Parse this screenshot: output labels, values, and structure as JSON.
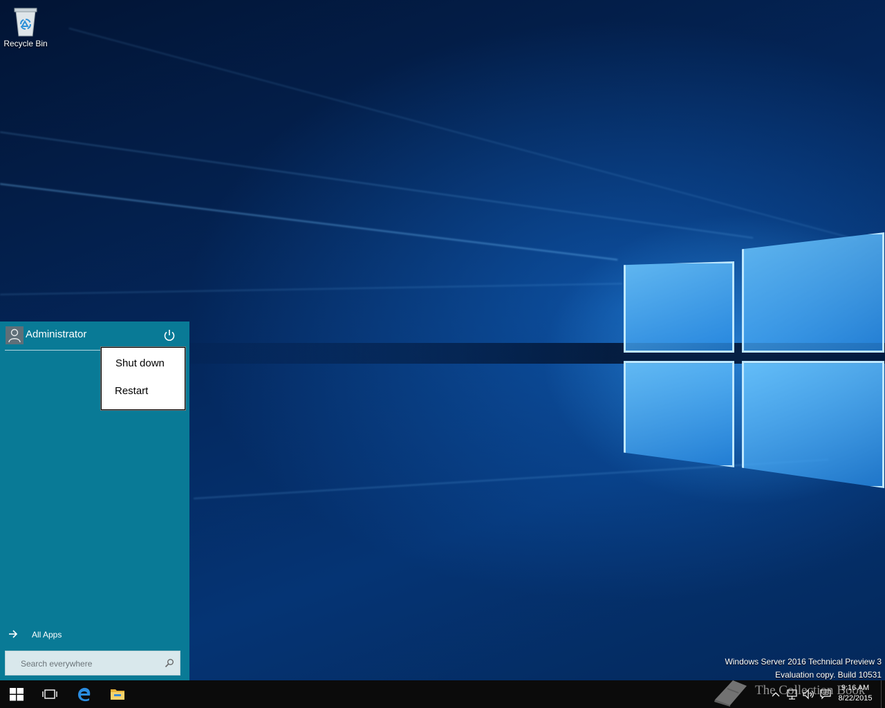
{
  "desktop": {
    "icons": [
      {
        "label": "Recycle Bin",
        "icon": "recycle-bin-icon"
      }
    ]
  },
  "start_menu": {
    "user": {
      "name": "Administrator",
      "icon": "user-avatar-icon"
    },
    "power_icon": "power-icon",
    "power_menu": {
      "items": [
        {
          "label": "Shut down"
        },
        {
          "label": "Restart"
        }
      ]
    },
    "all_apps_label": "All Apps",
    "search": {
      "placeholder": "Search everywhere",
      "value": ""
    }
  },
  "watermark": {
    "line1": "Windows Server 2016 Technical Preview 3",
    "line2": "Evaluation copy. Build 10531"
  },
  "overlay_logo": {
    "text": "The Collection Book"
  },
  "taskbar": {
    "buttons": [
      {
        "icon": "windows-start-icon"
      },
      {
        "icon": "task-view-icon"
      },
      {
        "icon": "edge-browser-icon"
      },
      {
        "icon": "file-explorer-icon"
      }
    ],
    "clock": {
      "time": "9:16 AM",
      "date": "8/22/2015"
    }
  },
  "colors": {
    "start_menu_bg": "#097a96",
    "taskbar_bg": "#0b0b0b",
    "desktop_bg": "#04285e"
  }
}
